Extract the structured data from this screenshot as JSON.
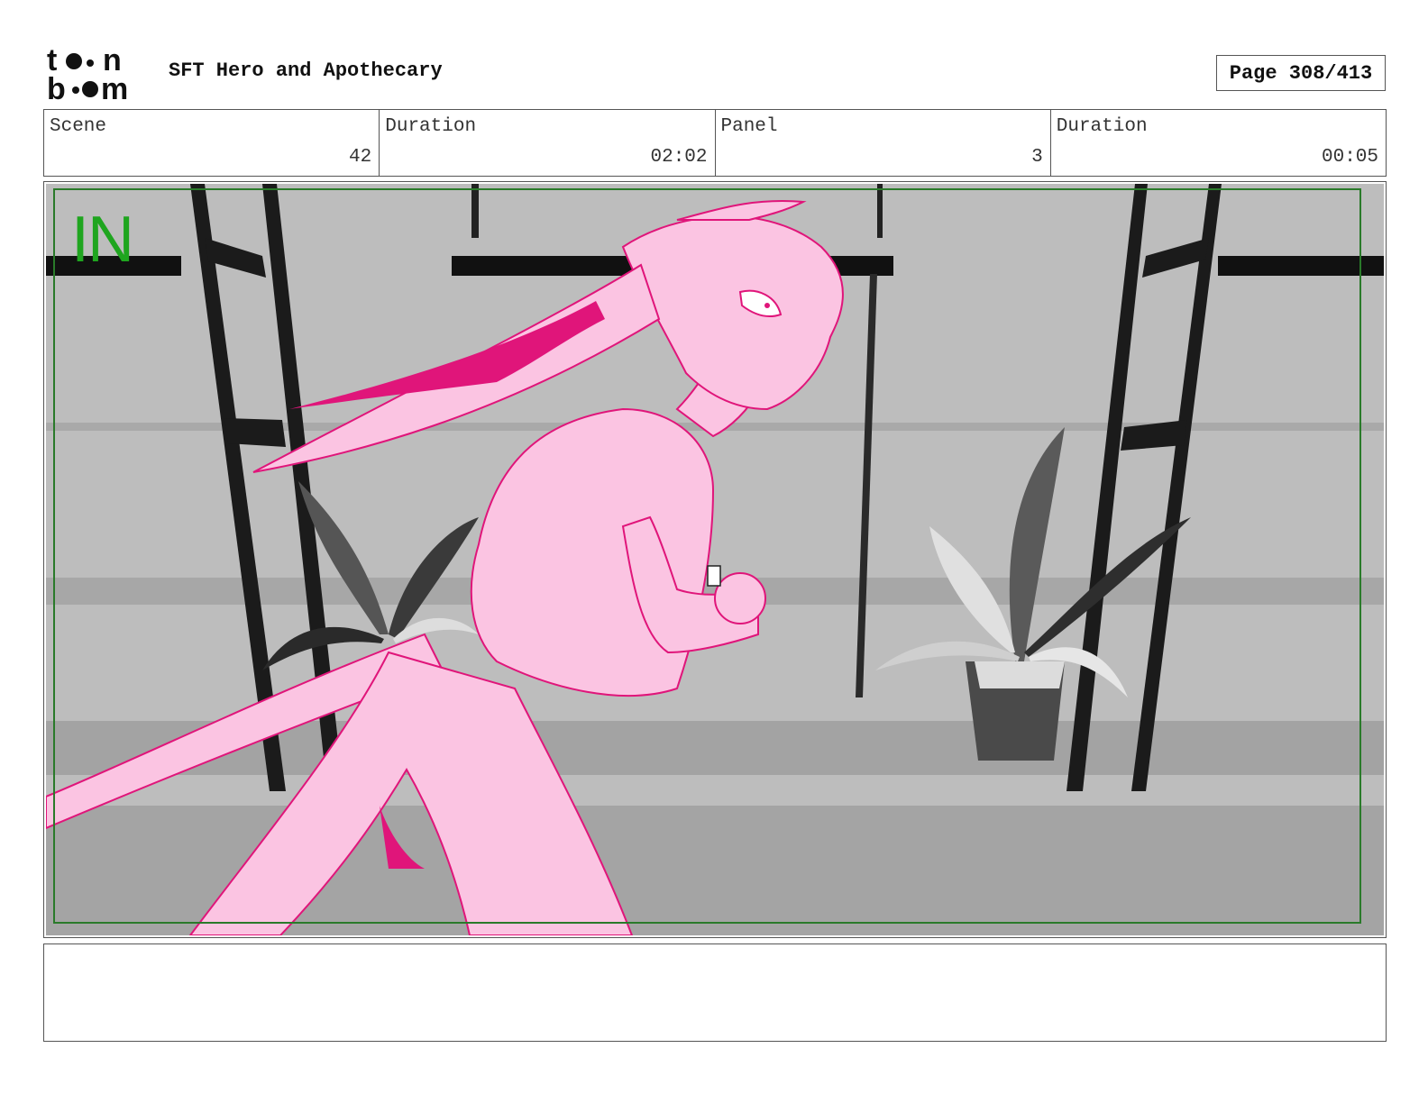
{
  "header": {
    "logo_text_top": "toon",
    "logo_text_bottom": "boom",
    "project_title": "SFT Hero and Apothecary",
    "page_label": "Page 308/413"
  },
  "info": [
    {
      "label": "Scene",
      "value": "42"
    },
    {
      "label": "Duration",
      "value": "02:02"
    },
    {
      "label": "Panel",
      "value": "3"
    },
    {
      "label": "Duration",
      "value": "00:05"
    }
  ],
  "panel": {
    "marker_text": "IN",
    "marker_color": "#1fa51f",
    "safe_frame_color": "#2a7a2a",
    "character_fill": "#fbc4e2",
    "character_line": "#e0157a"
  },
  "notes": {
    "text": ""
  }
}
